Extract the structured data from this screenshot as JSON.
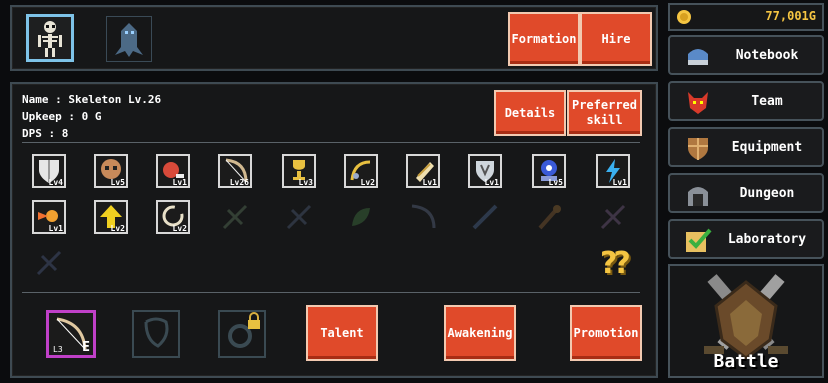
{
  "gold": "77,001G",
  "top_buttons": {
    "formation": "Formation",
    "hire": "Hire"
  },
  "unit_info": {
    "name_line": "Name : Skeleton Lv.26",
    "upkeep_line": "Upkeep : 0 G",
    "dps_line": "DPS : 8"
  },
  "detail_buttons": {
    "details": "Details",
    "preferred": "Preferred skill"
  },
  "skills_row1": [
    "Lv4",
    "Lv5",
    "Lv1",
    "Lv26",
    "Lv3",
    "Lv2",
    "Lv1",
    "Lv1",
    "Lv5",
    "Lv1"
  ],
  "skills_row2": [
    "Lv1",
    "Lv2",
    "Lv2"
  ],
  "unknown_mark": "??",
  "equip_slot_label": {
    "level": "L3",
    "grade": "E"
  },
  "bottom_buttons": {
    "talent": "Talent",
    "awakening": "Awakening",
    "promotion": "Promotion"
  },
  "sidebar": [
    {
      "label": "Notebook",
      "icon": "helmet-icon"
    },
    {
      "label": "Team",
      "icon": "demon-mask-icon"
    },
    {
      "label": "Equipment",
      "icon": "armor-icon"
    },
    {
      "label": "Dungeon",
      "icon": "dungeon-gate-icon"
    },
    {
      "label": "Laboratory",
      "icon": "check-icon"
    }
  ],
  "battle_label": "Battle",
  "colors": {
    "accent": "#e04a2a",
    "gold": "#f5c542",
    "frame": "#3e4a52"
  }
}
